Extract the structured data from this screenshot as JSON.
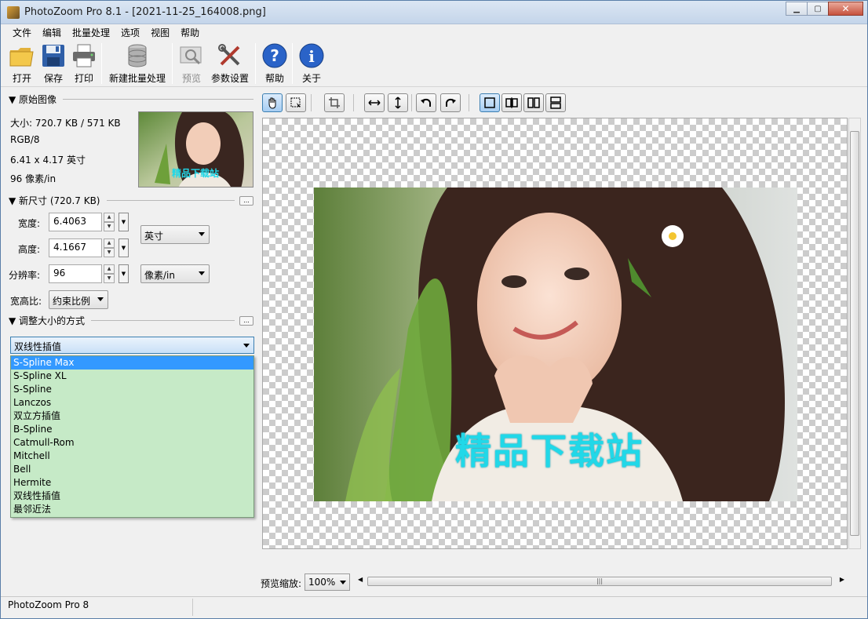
{
  "window": {
    "title": "PhotoZoom Pro 8.1 - [2021-11-25_164008.png]"
  },
  "menu": [
    "文件",
    "编辑",
    "批量处理",
    "选项",
    "视图",
    "帮助"
  ],
  "toolbar": {
    "open": "打开",
    "save": "保存",
    "print": "打印",
    "new_batch": "新建批量处理",
    "preview": "预览",
    "settings": "参数设置",
    "help": "帮助",
    "about": "关于"
  },
  "original_image": {
    "header": "▼ 原始图像",
    "size": "大小: 720.7 KB / 571 KB",
    "mode": "RGB/8",
    "dimensions": "6.41 x 4.17 英寸",
    "resolution": "96 像素/in"
  },
  "new_size": {
    "header": "▼ 新尺寸 (720.7 KB)",
    "width_label": "宽度:",
    "width_value": "6.4063",
    "height_label": "高度:",
    "height_value": "4.1667",
    "resolution_label": "分辨率:",
    "resolution_value": "96",
    "unit_size": "英寸",
    "unit_resolution": "像素/in",
    "aspect_label": "宽高比:",
    "aspect_value": "约束比例"
  },
  "resize_method": {
    "header": "▼ 调整大小的方式",
    "selected": "双线性插值",
    "options": [
      "S-Spline Max",
      "S-Spline XL",
      "S-Spline",
      "Lanczos",
      "双立方插值",
      "B-Spline",
      "Catmull-Rom",
      "Mitchell",
      "Bell",
      "Hermite",
      "双线性插值",
      "最邻近法"
    ],
    "highlighted_option": "S-Spline Max"
  },
  "preview": {
    "watermark": "精品下载站",
    "zoom_label": "预览缩放:",
    "zoom_value": "100%"
  },
  "status": {
    "text": "PhotoZoom Pro 8"
  },
  "colors": {
    "highlight": "#3399ff",
    "list_bg": "#c6eac7",
    "watermark": "#21d8e8"
  }
}
